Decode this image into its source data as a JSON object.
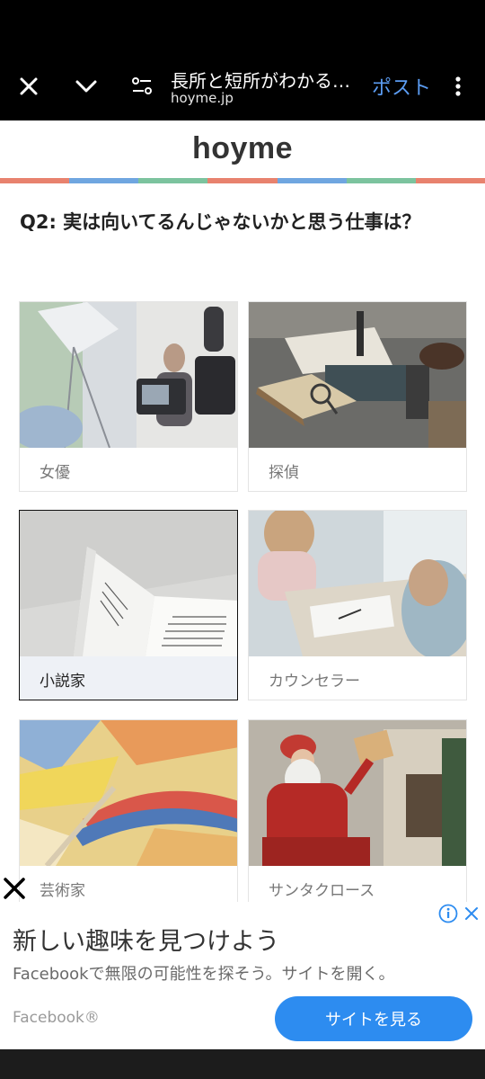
{
  "browser": {
    "title": "長所と短所がわかる…",
    "url": "hoyme.jp",
    "post_label": "ポスト",
    "icons": [
      "close-icon",
      "chevron-down-icon",
      "tune-icon",
      "more-vert-icon"
    ]
  },
  "site": {
    "logo": "hoyme",
    "stripe_colors": [
      "#e8826e",
      "#6fa6e0",
      "#7cc39e",
      "#e8826e",
      "#6fa6e0",
      "#7cc39e",
      "#e8826e"
    ]
  },
  "quiz": {
    "question": "Q2: 実は向いてるんじゃないかと思う仕事は？",
    "options": [
      {
        "label": "女優",
        "selected": false
      },
      {
        "label": "探偵",
        "selected": false
      },
      {
        "label": "小説家",
        "selected": true
      },
      {
        "label": "カウンセラー",
        "selected": false
      },
      {
        "label": "芸術家",
        "selected": false
      },
      {
        "label": "サンタクロース",
        "selected": false
      }
    ]
  },
  "ad": {
    "title": "新しい趣味を見つけよう",
    "description": "Facebookで無限の可能性を探そう。サイトを開く。",
    "brand": "Facebook®",
    "cta": "サイトを見る",
    "accent": "#2d8cf0"
  }
}
